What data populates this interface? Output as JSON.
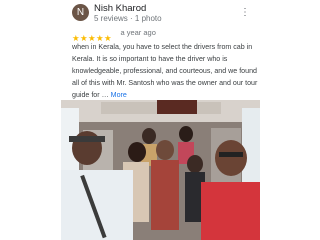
{
  "reviewer": {
    "initial": "N",
    "name": "Nish Kharod",
    "meta": "5 reviews · 1 photo"
  },
  "rating": {
    "stars": 5,
    "star_glyph": "★",
    "star_color": "#fbbc04",
    "date": "a year ago"
  },
  "review": {
    "text": "when in Kerala, you have to select the drivers from cab in Kerala. It is so important to have the driver who is knowledgeable, professional, and courteous, and we found all of this with Mr. Santosh who was the owner and our tour guide for …",
    "more_label": "More"
  },
  "icons": {
    "more_options": "more-vertical-icon"
  },
  "colors": {
    "link": "#1a73e8",
    "avatar_bg": "#6b5547",
    "secondary_text": "#70757a"
  }
}
